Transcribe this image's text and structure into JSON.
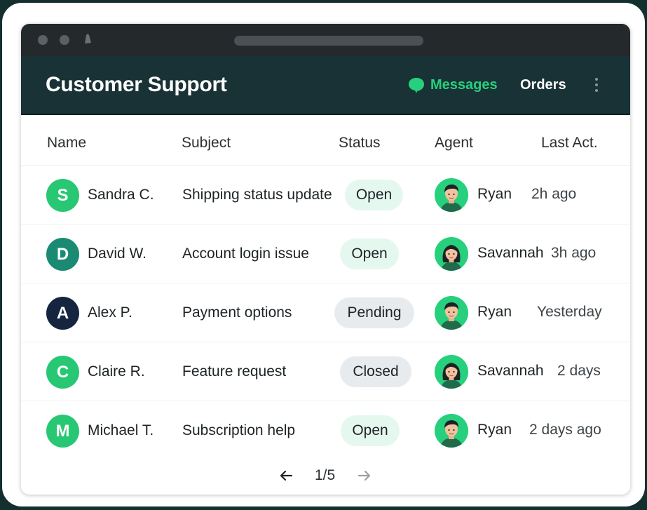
{
  "app": {
    "title": "Customer Support",
    "nav": {
      "messages": "Messages",
      "orders": "Orders"
    },
    "colors": {
      "accent": "#27d07c",
      "header_bg": "#193236",
      "titlebar_bg": "#24292c"
    }
  },
  "table": {
    "columns": [
      "Name",
      "Subject",
      "Status",
      "Agent",
      "Last Act."
    ],
    "rows": [
      {
        "initial": "S",
        "avatar_color": "#27c774",
        "name": "Sandra C.",
        "subject": "Shipping status update",
        "status": "Open",
        "agent": "Ryan",
        "agent_icon": "male-agent-avatar",
        "last": "2h ago"
      },
      {
        "initial": "D",
        "avatar_color": "#1a8a73",
        "name": "David W.",
        "subject": "Account login issue",
        "status": "Open",
        "agent": "Savannah",
        "agent_icon": "female-agent-avatar",
        "last": "3h ago"
      },
      {
        "initial": "A",
        "avatar_color": "#152540",
        "name": "Alex P.",
        "subject": "Payment options",
        "status": "Pending",
        "agent": "Ryan",
        "agent_icon": "male-agent-avatar",
        "last": "Yesterday"
      },
      {
        "initial": "C",
        "avatar_color": "#27c774",
        "name": "Claire R.",
        "subject": "Feature request",
        "status": "Closed",
        "agent": "Savannah",
        "agent_icon": "female-agent-avatar",
        "last": "2 days"
      },
      {
        "initial": "M",
        "avatar_color": "#27c774",
        "name": "Michael T.",
        "subject": "Subscription help",
        "status": "Open",
        "agent": "Ryan",
        "agent_icon": "male-agent-avatar",
        "last": "2 days ago"
      }
    ]
  },
  "pagination": {
    "label": "1/5"
  }
}
